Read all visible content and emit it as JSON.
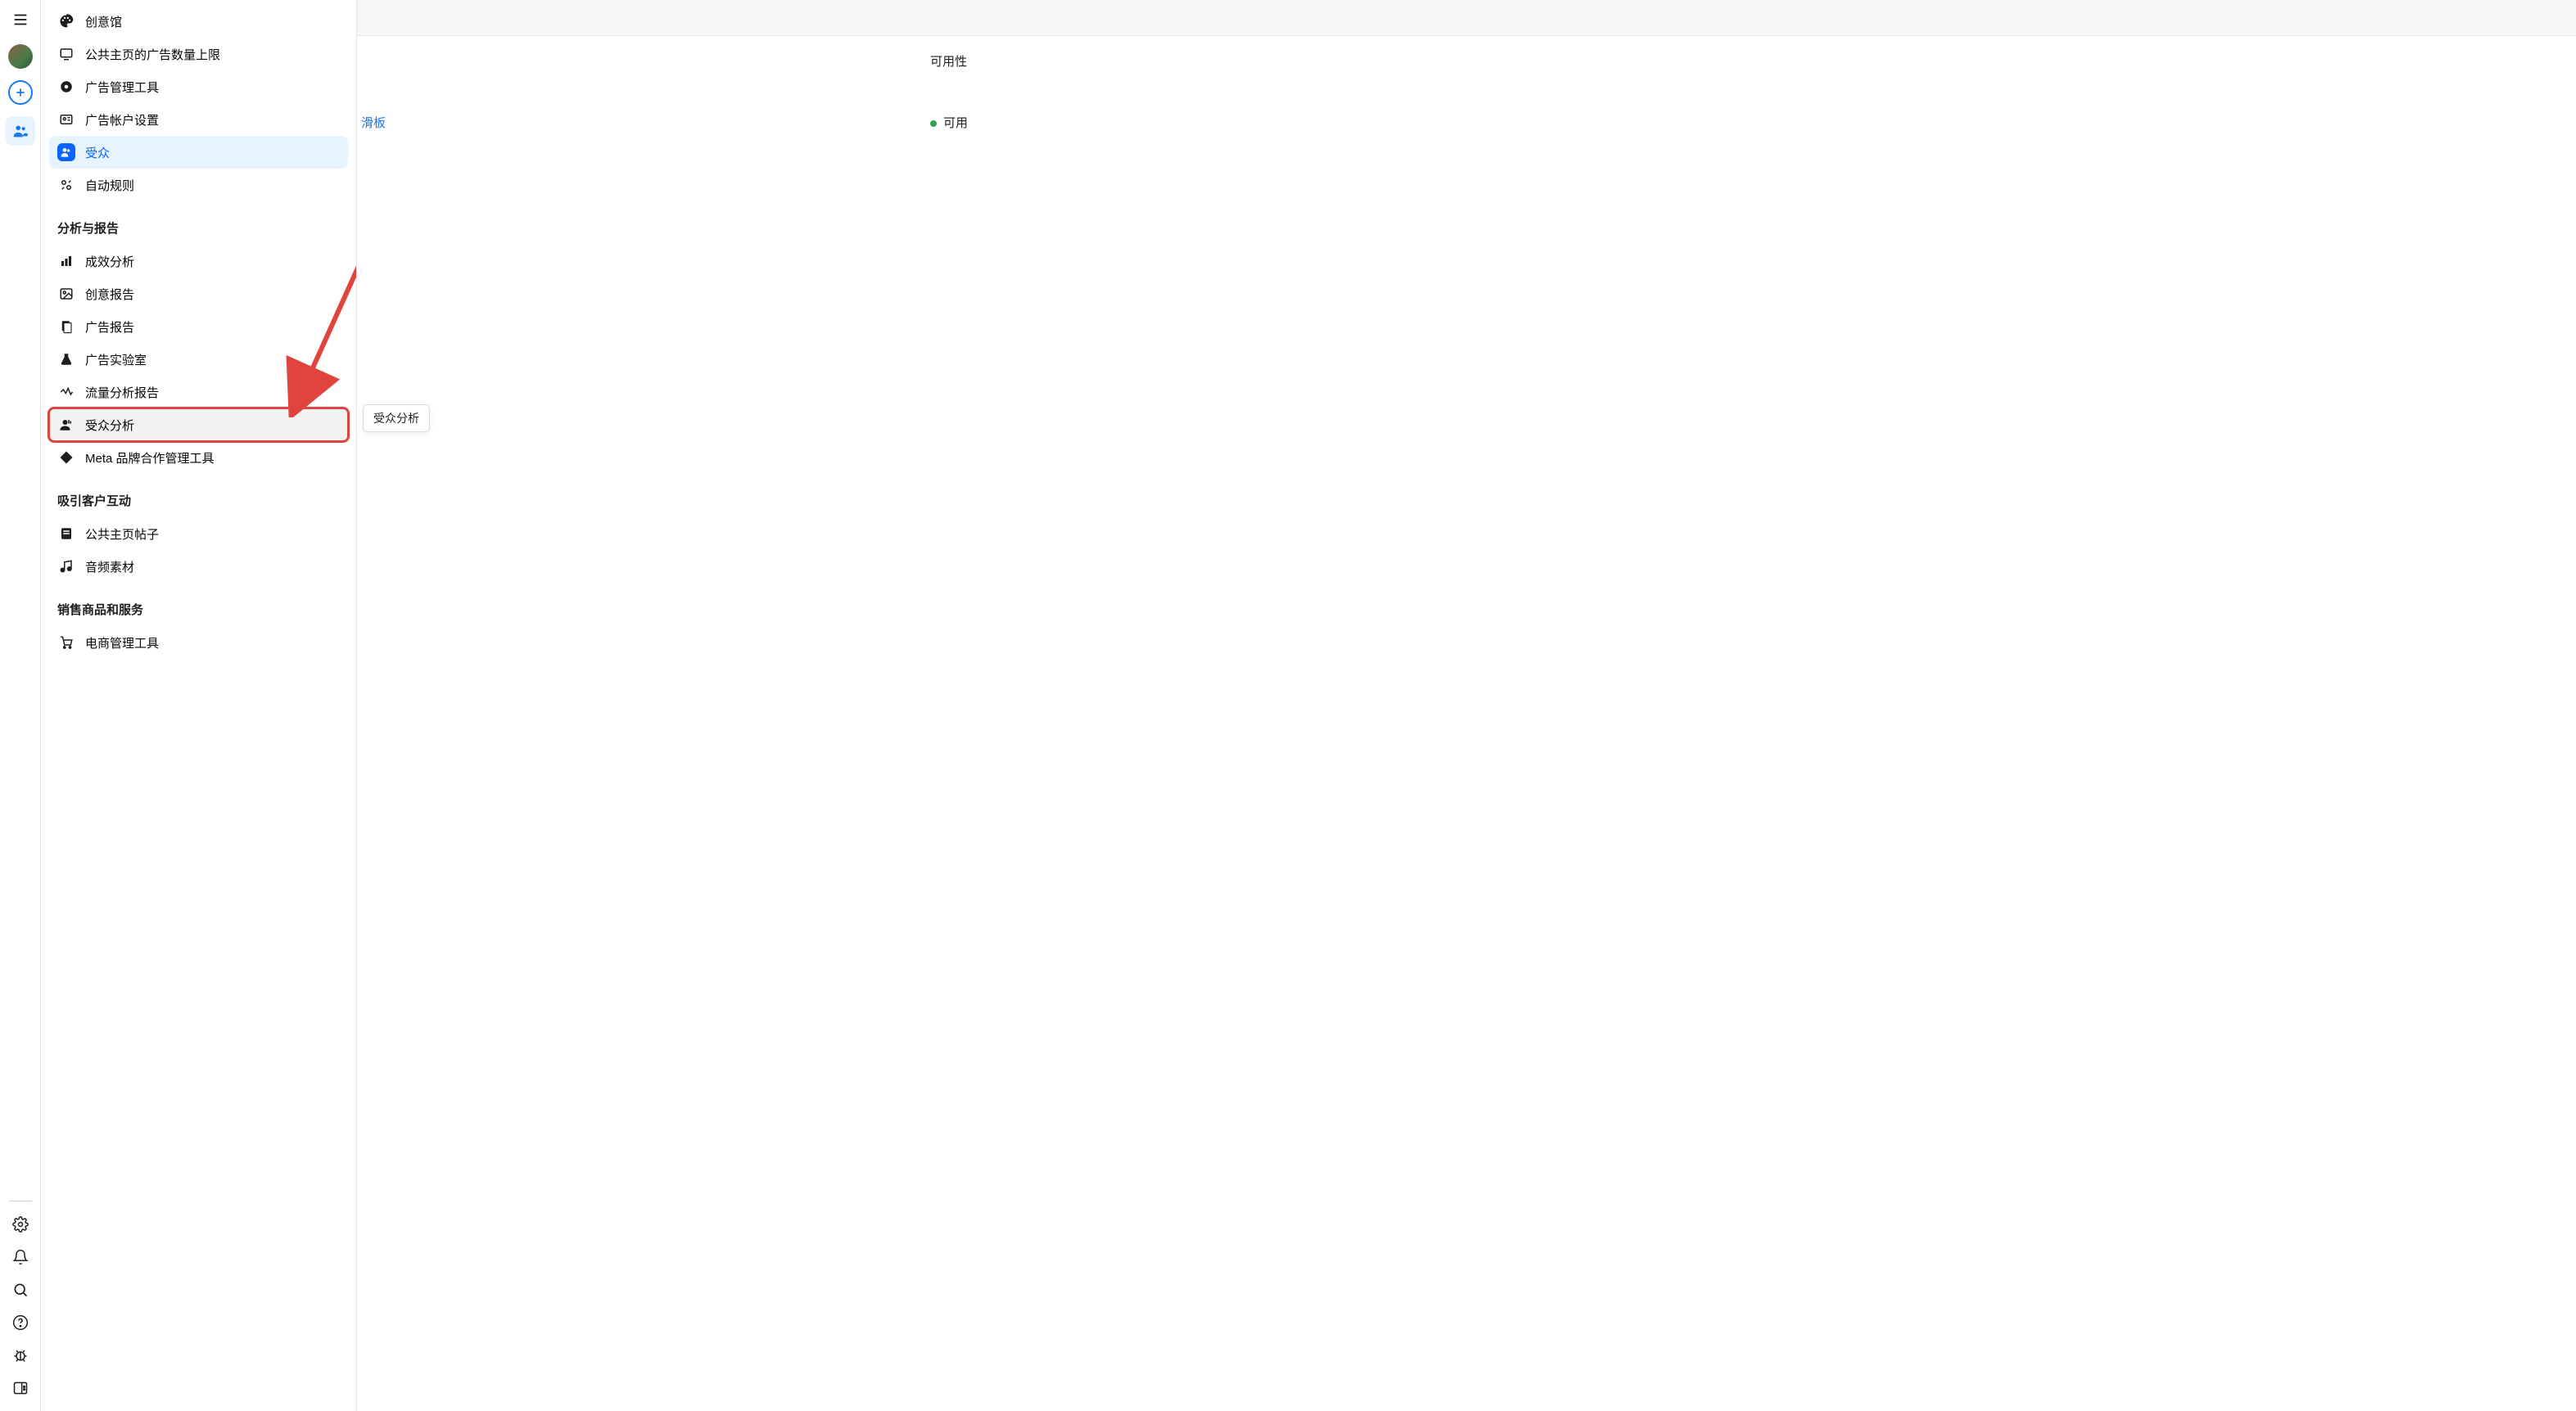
{
  "sidebar": {
    "top_items": [
      {
        "icon": "palette",
        "label": "创意馆"
      },
      {
        "icon": "monitor",
        "label": "公共主页的广告数量上限"
      },
      {
        "icon": "target",
        "label": "广告管理工具"
      },
      {
        "icon": "id",
        "label": "广告帐户设置"
      },
      {
        "icon": "audience",
        "label": "受众",
        "selected": true
      },
      {
        "icon": "auto",
        "label": "自动规则"
      }
    ],
    "sections": [
      {
        "title": "分析与报告",
        "items": [
          {
            "icon": "bar",
            "label": "成效分析"
          },
          {
            "icon": "image",
            "label": "创意报告"
          },
          {
            "icon": "doc",
            "label": "广告报告"
          },
          {
            "icon": "flask",
            "label": "广告实验室"
          },
          {
            "icon": "activity",
            "label": "流量分析报告"
          },
          {
            "icon": "person",
            "label": "受众分析",
            "highlight": true
          },
          {
            "icon": "diamond",
            "label": "Meta 品牌合作管理工具"
          }
        ]
      },
      {
        "title": "吸引客户互动",
        "items": [
          {
            "icon": "page",
            "label": "公共主页帖子"
          },
          {
            "icon": "music",
            "label": "音频素材"
          }
        ]
      },
      {
        "title": "销售商品和服务",
        "items": [
          {
            "icon": "cart",
            "label": "电商管理工具"
          }
        ]
      }
    ]
  },
  "tooltip": {
    "label": "受众分析"
  },
  "main": {
    "availability_header": "可用性",
    "row_link": "滑板",
    "status": "可用"
  },
  "colors": {
    "primary": "#1877f2",
    "highlight": "#e0443e",
    "success": "#31a24c"
  }
}
